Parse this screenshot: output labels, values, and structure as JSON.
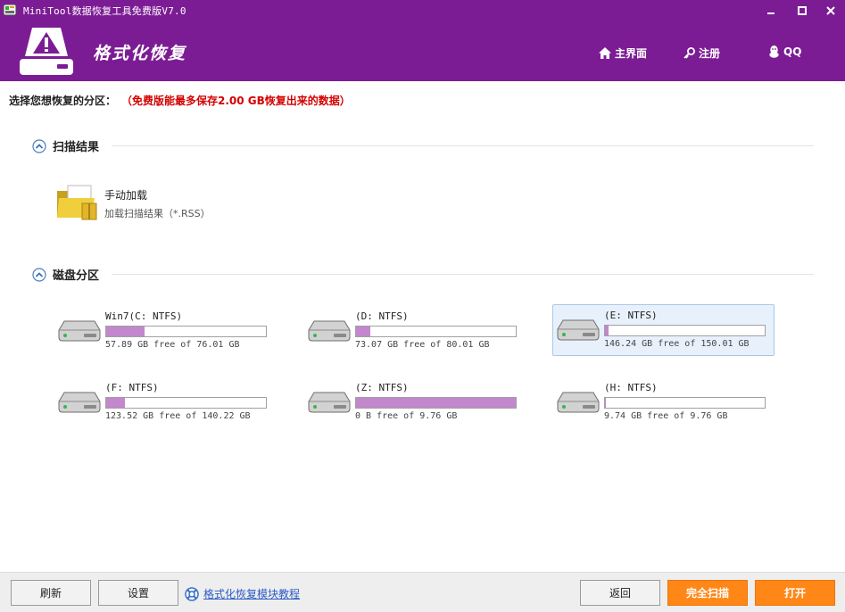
{
  "window": {
    "title": "MiniTool数据恢复工具免费版V7.0"
  },
  "header": {
    "module_title": "格式化恢复",
    "nav": {
      "home": "主界面",
      "register": "注册",
      "qq": "QQ"
    }
  },
  "select": {
    "label": "选择您想恢复的分区：",
    "note": "（免费版能最多保存2.00 GB恢复出来的数据）"
  },
  "scan_results": {
    "heading": "扫描结果",
    "manual_load": {
      "title": "手动加载",
      "subtitle": "加载扫描结果（*.RSS）"
    }
  },
  "partitions": {
    "heading": "磁盘分区",
    "drives": [
      {
        "name": "Win7(C: NTFS)",
        "free_text": "57.89 GB free of 76.01 GB",
        "used_fraction": 0.238
      },
      {
        "name": "(D: NTFS)",
        "free_text": "73.07 GB free of 80.01 GB",
        "used_fraction": 0.087
      },
      {
        "name": "(E: NTFS)",
        "free_text": "146.24 GB free of 150.01 GB",
        "used_fraction": 0.025
      },
      {
        "name": "(F: NTFS)",
        "free_text": "123.52 GB free of 140.22 GB",
        "used_fraction": 0.119
      },
      {
        "name": "(Z: NTFS)",
        "free_text": "0 B free of 9.76 GB",
        "used_fraction": 1.0
      },
      {
        "name": "(H: NTFS)",
        "free_text": "9.74 GB free of 9.76 GB",
        "used_fraction": 0.002
      }
    ]
  },
  "footer": {
    "refresh": "刷新",
    "settings": "设置",
    "help_link": "格式化恢复模块教程",
    "back": "返回",
    "full_scan": "完全扫描",
    "open": "打开"
  },
  "colors": {
    "brand_purple": "#7c1c94",
    "usage_fill": "#c287cc",
    "accent_orange": "#ff8717",
    "note_red": "#d40000",
    "selection_bg": "#e8f1fb"
  }
}
